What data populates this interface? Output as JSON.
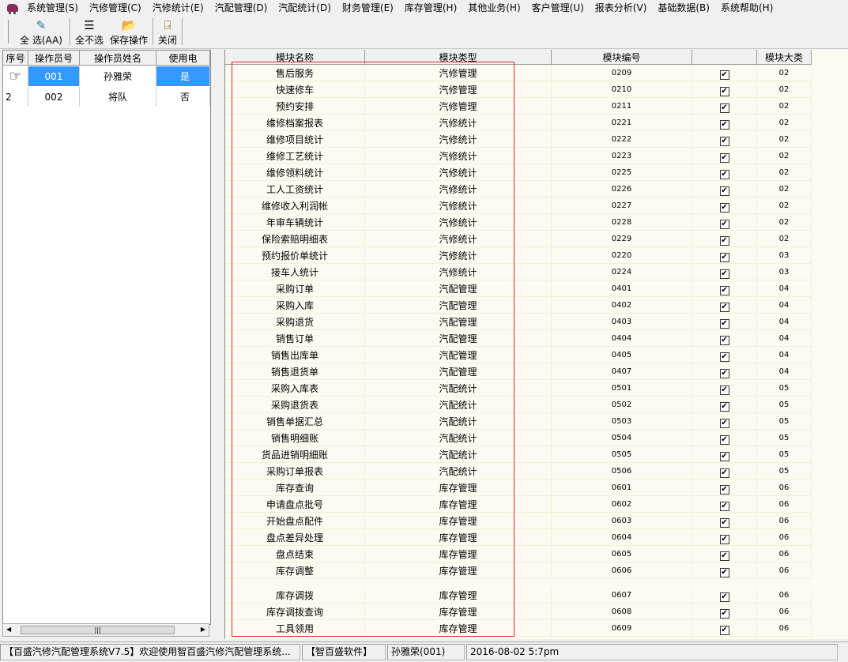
{
  "menu": [
    "系统管理(S)",
    "汽修管理(C)",
    "汽修统计(E)",
    "汽配管理(D)",
    "汽配统计(D)",
    "财务管理(E)",
    "库存管理(H)",
    "其他业务(H)",
    "客户管理(U)",
    "报表分析(V)",
    "基础数据(B)",
    "系统帮助(H)"
  ],
  "toolbar": {
    "select_all": "全  选(AA)",
    "select_none": "全不选",
    "save": "保存操作",
    "close": "关闭"
  },
  "operators": {
    "headers": [
      "序号",
      "操作员号",
      "操作员姓名",
      "使用电"
    ],
    "rows": [
      {
        "seq": "",
        "id": "001",
        "name": "孙雅荣",
        "use": "是"
      },
      {
        "seq": "2",
        "id": "002",
        "name": "将队",
        "use": "否"
      }
    ]
  },
  "modules": {
    "headers": [
      "模块名称",
      "模块类型",
      "模块编号",
      "",
      "模块大类"
    ],
    "rows": [
      {
        "name": "售后服务",
        "type": "汽修管理",
        "code": "0209",
        "cat": "02"
      },
      {
        "name": "快速修车",
        "type": "汽修管理",
        "code": "0210",
        "cat": "02"
      },
      {
        "name": "预约安排",
        "type": "汽修管理",
        "code": "0211",
        "cat": "02"
      },
      {
        "name": "维修档案报表",
        "type": "汽修统计",
        "code": "0221",
        "cat": "02"
      },
      {
        "name": "维修项目统计",
        "type": "汽修统计",
        "code": "0222",
        "cat": "02"
      },
      {
        "name": "维修工艺统计",
        "type": "汽修统计",
        "code": "0223",
        "cat": "02"
      },
      {
        "name": "维修领料统计",
        "type": "汽修统计",
        "code": "0225",
        "cat": "02"
      },
      {
        "name": "工人工资统计",
        "type": "汽修统计",
        "code": "0226",
        "cat": "02"
      },
      {
        "name": "维修收入利润帐",
        "type": "汽修统计",
        "code": "0227",
        "cat": "02"
      },
      {
        "name": "年审车辆统计",
        "type": "汽修统计",
        "code": "0228",
        "cat": "02"
      },
      {
        "name": "保险索赔明细表",
        "type": "汽修统计",
        "code": "0229",
        "cat": "02"
      },
      {
        "name": "预约报价单统计",
        "type": "汽修统计",
        "code": "0220",
        "cat": "03"
      },
      {
        "name": "接车人统计",
        "type": "汽修统计",
        "code": "0224",
        "cat": "03"
      },
      {
        "name": "采购订单",
        "type": "汽配管理",
        "code": "0401",
        "cat": "04"
      },
      {
        "name": "采购入库",
        "type": "汽配管理",
        "code": "0402",
        "cat": "04"
      },
      {
        "name": "采购退货",
        "type": "汽配管理",
        "code": "0403",
        "cat": "04"
      },
      {
        "name": "销售订单",
        "type": "汽配管理",
        "code": "0404",
        "cat": "04"
      },
      {
        "name": "销售出库单",
        "type": "汽配管理",
        "code": "0405",
        "cat": "04"
      },
      {
        "name": "销售退货单",
        "type": "汽配管理",
        "code": "0407",
        "cat": "04"
      },
      {
        "name": "采购入库表",
        "type": "汽配统计",
        "code": "0501",
        "cat": "05"
      },
      {
        "name": "采购退货表",
        "type": "汽配统计",
        "code": "0502",
        "cat": "05"
      },
      {
        "name": "销售单据汇总",
        "type": "汽配统计",
        "code": "0503",
        "cat": "05"
      },
      {
        "name": "销售明细账",
        "type": "汽配统计",
        "code": "0504",
        "cat": "05"
      },
      {
        "name": "货品进销明细账",
        "type": "汽配统计",
        "code": "0505",
        "cat": "05"
      },
      {
        "name": "采购订单报表",
        "type": "汽配统计",
        "code": "0506",
        "cat": "05"
      },
      {
        "name": "库存查询",
        "type": "库存管理",
        "code": "0601",
        "cat": "06"
      },
      {
        "name": "申请盘点批号",
        "type": "库存管理",
        "code": "0602",
        "cat": "06"
      },
      {
        "name": "开始盘点配件",
        "type": "库存管理",
        "code": "0603",
        "cat": "06"
      },
      {
        "name": "盘点差异处理",
        "type": "库存管理",
        "code": "0604",
        "cat": "06"
      },
      {
        "name": "盘点结束",
        "type": "库存管理",
        "code": "0605",
        "cat": "06"
      },
      {
        "name": "库存调整",
        "type": "库存管理",
        "code": "0606",
        "cat": "06"
      },
      {
        "name": "库存调拨",
        "type": "库存管理",
        "code": "0607",
        "cat": "06"
      },
      {
        "name": "库存调拨查询",
        "type": "库存管理",
        "code": "0608",
        "cat": "06"
      },
      {
        "name": "工具领用",
        "type": "库存管理",
        "code": "0609",
        "cat": "06"
      }
    ]
  },
  "status": {
    "app": "【百盛汽修汽配管理系统V7.5】欢迎使用智百盛汽修汽配管理系统...",
    "vendor": "【智百盛软件】",
    "user": "孙雅荣(001)",
    "datetime": "2016-08-02 5:7pm"
  },
  "colors": {
    "selection": "#3399ff",
    "grid_bg": "#fdfbf1",
    "highlight_box": "#d9302f"
  }
}
